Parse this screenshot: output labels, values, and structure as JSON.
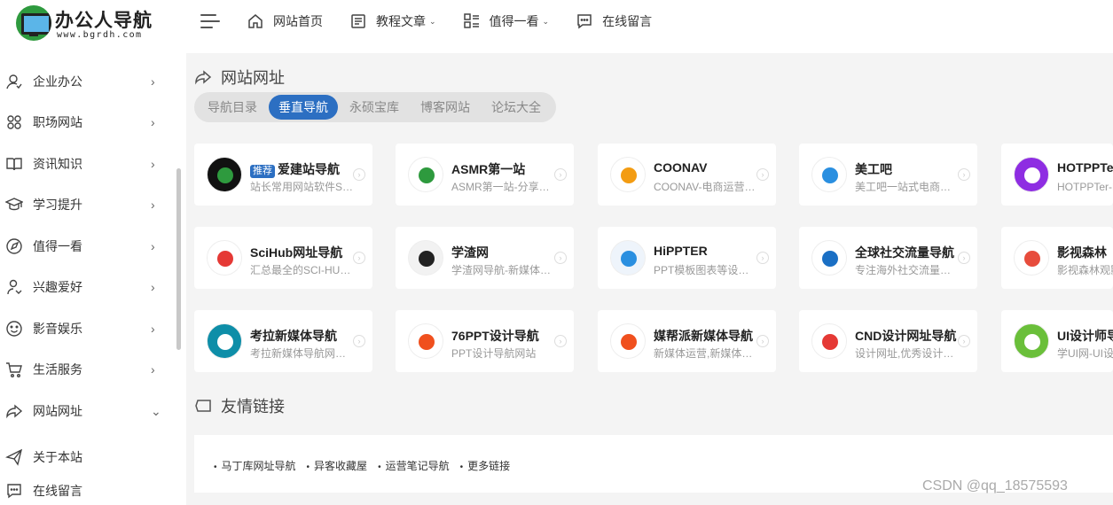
{
  "header": {
    "logo_title": "办公人导航",
    "logo_url_text": "www.bgrdh.com",
    "nav": [
      {
        "label": "网站首页",
        "icon": "home-icon",
        "dropdown": false
      },
      {
        "label": "教程文章",
        "icon": "document-icon",
        "dropdown": true
      },
      {
        "label": "值得一看",
        "icon": "grid-list-icon",
        "dropdown": true
      },
      {
        "label": "在线留言",
        "icon": "message-icon",
        "dropdown": false
      }
    ]
  },
  "sidebar": {
    "items": [
      {
        "label": "企业办公",
        "icon": "user-icon",
        "arrow": "›"
      },
      {
        "label": "职场网站",
        "icon": "apps-icon",
        "arrow": "›"
      },
      {
        "label": "资讯知识",
        "icon": "book-icon",
        "arrow": "›"
      },
      {
        "label": "学习提升",
        "icon": "graduation-cap-icon",
        "arrow": "›"
      },
      {
        "label": "值得一看",
        "icon": "compass-icon",
        "arrow": "›"
      },
      {
        "label": "兴趣爱好",
        "icon": "person-icon",
        "arrow": "›"
      },
      {
        "label": "影音娱乐",
        "icon": "smile-icon",
        "arrow": "›"
      },
      {
        "label": "生活服务",
        "icon": "cart-icon",
        "arrow": "›"
      },
      {
        "label": "网站网址",
        "icon": "share-icon",
        "arrow": "⌄"
      },
      {
        "label": "关于本站",
        "icon": "paper-plane-icon",
        "arrow": ""
      },
      {
        "label": "在线留言",
        "icon": "message-icon",
        "arrow": ""
      }
    ]
  },
  "main": {
    "section_title": "网站网址",
    "tabs": [
      "导航目录",
      "垂直导航",
      "永硕宝库",
      "博客网站",
      "论坛大全"
    ],
    "active_tab": "垂直导航",
    "badge": "推荐",
    "cards": [
      {
        "name": "爱建站导航",
        "desc": "站长常用网站软件SEO工具",
        "colors": {
          "bg": "#111111",
          "fg": "#2e9a3e"
        }
      },
      {
        "name": "ASMR第一站",
        "desc": "ASMR第一站-分享全网ASMR",
        "colors": {
          "bg": "#ffffff",
          "fg": "#2e9a3e"
        }
      },
      {
        "name": "COONAV",
        "desc": "COONAV-电商运营导航",
        "colors": {
          "bg": "#ffffff",
          "fg": "#f39c12"
        }
      },
      {
        "name": "美工吧",
        "desc": "美工吧一站式电商美工导航",
        "colors": {
          "bg": "#ffffff",
          "fg": "#2a8fe0"
        }
      },
      {
        "name": "HOTPPTer",
        "desc": "HOTPPTer-PPT资源导航",
        "colors": {
          "bg": "#8e2de2",
          "fg": "#ffffff"
        }
      },
      {
        "name": "SciHub网址导航",
        "desc": "汇总最全的SCI-HUB网址",
        "colors": {
          "bg": "#ffffff",
          "fg": "#e53935"
        }
      },
      {
        "name": "学渣网",
        "desc": "学渣网导航-新媒体运营",
        "colors": {
          "bg": "#f2f2f2",
          "fg": "#222222"
        }
      },
      {
        "name": "HiPPTER",
        "desc": "PPT模板图表等设计资源",
        "colors": {
          "bg": "#eef4fb",
          "fg": "#2a8fe0"
        }
      },
      {
        "name": "全球社交流量导航",
        "desc": "专注海外社交流量推广",
        "colors": {
          "bg": "#ffffff",
          "fg": "#1a6fc4"
        }
      },
      {
        "name": "影视森林",
        "desc": "影视森林观影导航",
        "colors": {
          "bg": "#ffffff",
          "fg": "#e74c3c"
        }
      },
      {
        "name": "考拉新媒体导航",
        "desc": "考拉新媒体导航网站大全",
        "colors": {
          "bg": "#0e8ea8",
          "fg": "#ffffff"
        }
      },
      {
        "name": "76PPT设计导航",
        "desc": "PPT设计导航网站",
        "colors": {
          "bg": "#ffffff",
          "fg": "#f0501e"
        }
      },
      {
        "name": "媒帮派新媒体导航",
        "desc": "新媒体运营,新媒体导航",
        "colors": {
          "bg": "#ffffff",
          "fg": "#f0501e"
        }
      },
      {
        "name": "CND设计网址导航",
        "desc": "设计网址,优秀设计网站",
        "colors": {
          "bg": "#ffffff",
          "fg": "#e53935"
        }
      },
      {
        "name": "UI设计师导航",
        "desc": "学UI网-UI设计师导航",
        "colors": {
          "bg": "#6abf3a",
          "fg": "#ffffff"
        }
      }
    ]
  },
  "friends": {
    "title": "友情链接",
    "links": [
      "马丁库网址导航",
      "异客收藏屋",
      "运营笔记导航",
      "更多链接"
    ]
  },
  "watermark": "CSDN @qq_18575593",
  "colors": {
    "accent": "#2c6fc2",
    "background": "#f4f4f4",
    "card": "#ffffff"
  }
}
